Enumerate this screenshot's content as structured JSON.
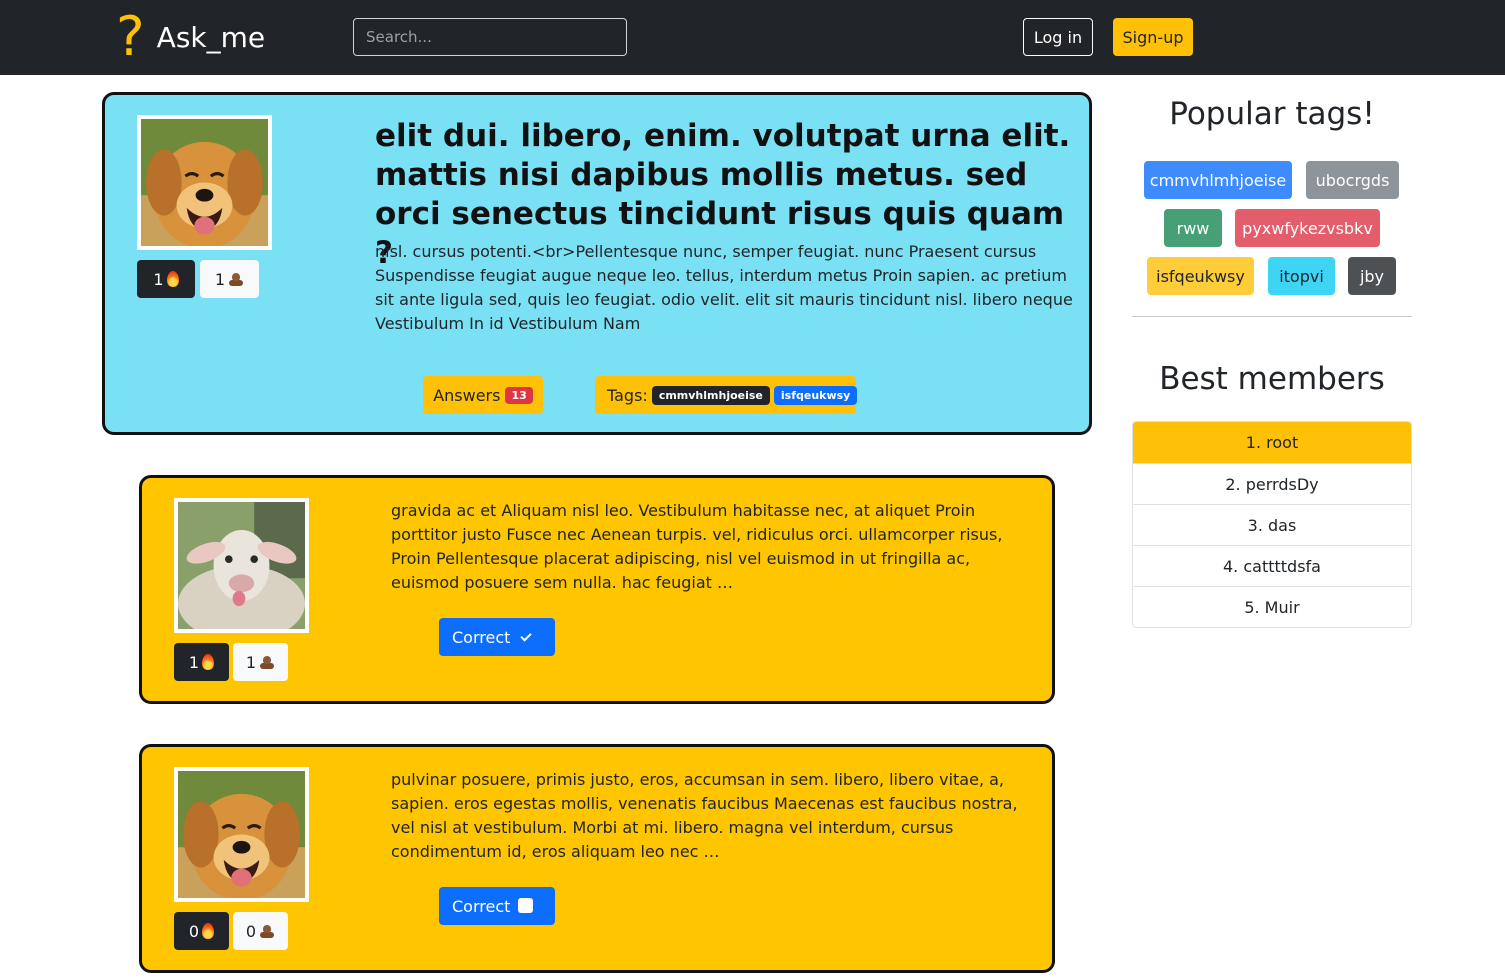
{
  "header": {
    "brand_mark": "?",
    "brand_name": "Ask_me",
    "search_placeholder": "Search...",
    "login_label": "Log in",
    "signup_label": "Sign-up"
  },
  "question": {
    "avatar": "dog-avatar",
    "likes": "1",
    "dislikes": "1",
    "title": "elit dui. libero, enim. volutpat urna elit. mattis nisi dapibus mollis metus. sed orci senectus tincidunt risus quis quam ?",
    "body": "nisl. cursus potenti.<br>Pellentesque nunc, semper feugiat. nunc Praesent cursus Suspendisse feugiat augue neque leo. tellus, interdum metus Proin sapien. ac pretium sit ante ligula sed, quis leo feugiat. odio velit. elit sit mauris tincidunt nisl. libero neque Vestibulum In id Vestibulum Nam",
    "answers_label": "Answers",
    "answers_count": "13",
    "tags_label": "Tags:",
    "tags": [
      "cmmvhlmhjoeise",
      "isfqeukwsy"
    ]
  },
  "answers": [
    {
      "avatar": "sheep-avatar",
      "likes": "1",
      "dislikes": "1",
      "body": "gravida ac et Aliquam nisl leo. Vestibulum habitasse nec, at aliquet Proin porttitor justo Fusce nec Aenean turpis. vel, ridiculus orci. ullamcorper risus, Proin Pellentesque placerat adipiscing, nisl vel euismod in ut fringilla ac, euismod posuere sem nulla. hac feugiat …",
      "correct_label": "Correct",
      "correct_checked": true
    },
    {
      "avatar": "dog-avatar",
      "likes": "0",
      "dislikes": "0",
      "body": "pulvinar posuere, primis justo, eros, accumsan in sem. libero, libero vitae, a, sapien. eros egestas mollis, venenatis faucibus Maecenas est faucibus nostra, vel nisl at vestibulum. Morbi at mi. libero. magna vel interdum, cursus condimentum id, eros aliquam leo nec …",
      "correct_label": "Correct",
      "correct_checked": false
    }
  ],
  "sidebar": {
    "popular_title": "Popular tags!",
    "tags": [
      {
        "label": "cmmvhlmhjoeise",
        "color": "#3d8bfd"
      },
      {
        "label": "ubocrgds",
        "color": "#8d949a"
      },
      {
        "label": "rww",
        "color": "#479f76"
      },
      {
        "label": "pyxwfykezvsbkv",
        "color": "#e35d6a"
      },
      {
        "label": "isfqeukwsy",
        "color": "#ffcd39"
      },
      {
        "label": "itopvi",
        "color": "#3dd5f3"
      },
      {
        "label": "jby",
        "color": "#4d5154"
      }
    ],
    "members_title": "Best members",
    "members": [
      "1. root",
      "2. perrdsDy",
      "3. das",
      "4. cattttdsfa",
      "5. Muir"
    ]
  },
  "colors": {
    "navbar": "#212529",
    "accent": "#ffc107",
    "question_bg": "#7ae0f4",
    "answer_bg": "#ffc600",
    "primary": "#0d6efd",
    "danger": "#dc3545"
  }
}
